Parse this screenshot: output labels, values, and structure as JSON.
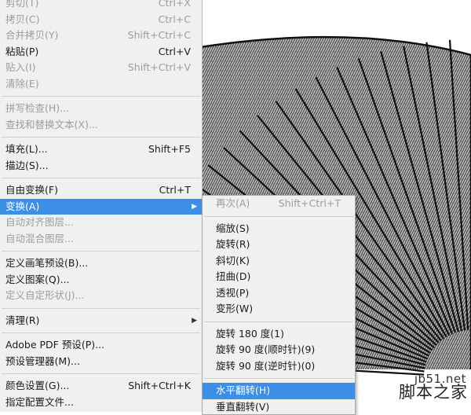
{
  "edit_menu": {
    "items": [
      {
        "label": "剪切(T)",
        "shortcut": "Ctrl+X",
        "disabled": true
      },
      {
        "label": "拷贝(C)",
        "shortcut": "Ctrl+C",
        "disabled": true
      },
      {
        "label": "合并拷贝(Y)",
        "shortcut": "Shift+Ctrl+C",
        "disabled": true
      },
      {
        "label": "粘贴(P)",
        "shortcut": "Ctrl+V",
        "disabled": false
      },
      {
        "label": "贴入(I)",
        "shortcut": "Shift+Ctrl+V",
        "disabled": true
      },
      {
        "label": "清除(E)",
        "shortcut": "",
        "disabled": true
      },
      {
        "label": "拼写检查(H)...",
        "shortcut": "",
        "disabled": true
      },
      {
        "label": "查找和替换文本(X)...",
        "shortcut": "",
        "disabled": true
      },
      {
        "label": "填充(L)...",
        "shortcut": "Shift+F5",
        "disabled": false
      },
      {
        "label": "描边(S)...",
        "shortcut": "",
        "disabled": false
      },
      {
        "label": "自由变换(F)",
        "shortcut": "Ctrl+T",
        "disabled": false
      },
      {
        "label": "变换(A)",
        "shortcut": "",
        "disabled": false
      },
      {
        "label": "自动对齐图层...",
        "shortcut": "",
        "disabled": true
      },
      {
        "label": "自动混合图层...",
        "shortcut": "",
        "disabled": true
      },
      {
        "label": "定义画笔预设(B)...",
        "shortcut": "",
        "disabled": false
      },
      {
        "label": "定义图案(Q)...",
        "shortcut": "",
        "disabled": false
      },
      {
        "label": "定义自定形状(J)...",
        "shortcut": "",
        "disabled": true
      },
      {
        "label": "清理(R)",
        "shortcut": "",
        "disabled": false
      },
      {
        "label": "Adobe PDF 预设(P)...",
        "shortcut": "",
        "disabled": false
      },
      {
        "label": "预设管理器(M)...",
        "shortcut": "",
        "disabled": false
      },
      {
        "label": "颜色设置(G)...",
        "shortcut": "Shift+Ctrl+K",
        "disabled": false
      },
      {
        "label": "指定配置文件...",
        "shortcut": "",
        "disabled": false
      }
    ]
  },
  "transform_submenu": {
    "items": [
      {
        "label": "再次(A)",
        "shortcut": "Shift+Ctrl+T",
        "disabled": true
      },
      {
        "label": "缩放(S)",
        "shortcut": "",
        "disabled": false
      },
      {
        "label": "旋转(R)",
        "shortcut": "",
        "disabled": false
      },
      {
        "label": "斜切(K)",
        "shortcut": "",
        "disabled": false
      },
      {
        "label": "扭曲(D)",
        "shortcut": "",
        "disabled": false
      },
      {
        "label": "透视(P)",
        "shortcut": "",
        "disabled": false
      },
      {
        "label": "变形(W)",
        "shortcut": "",
        "disabled": false
      },
      {
        "label": "旋转 180 度(1)",
        "shortcut": "",
        "disabled": false
      },
      {
        "label": "旋转 90 度(顺时针)(9)",
        "shortcut": "",
        "disabled": false
      },
      {
        "label": "旋转 90 度(逆时针)(0)",
        "shortcut": "",
        "disabled": false
      },
      {
        "label": "水平翻转(H)",
        "shortcut": "",
        "disabled": false
      },
      {
        "label": "垂直翻转(V)",
        "shortcut": "",
        "disabled": false
      }
    ]
  },
  "watermark": {
    "url": "jb51.net",
    "text": "脚本之家"
  },
  "colors": {
    "menu_bg": "#f0f0f0",
    "highlight": "#3d8ee6",
    "disabled_text": "#9c9c9c"
  }
}
